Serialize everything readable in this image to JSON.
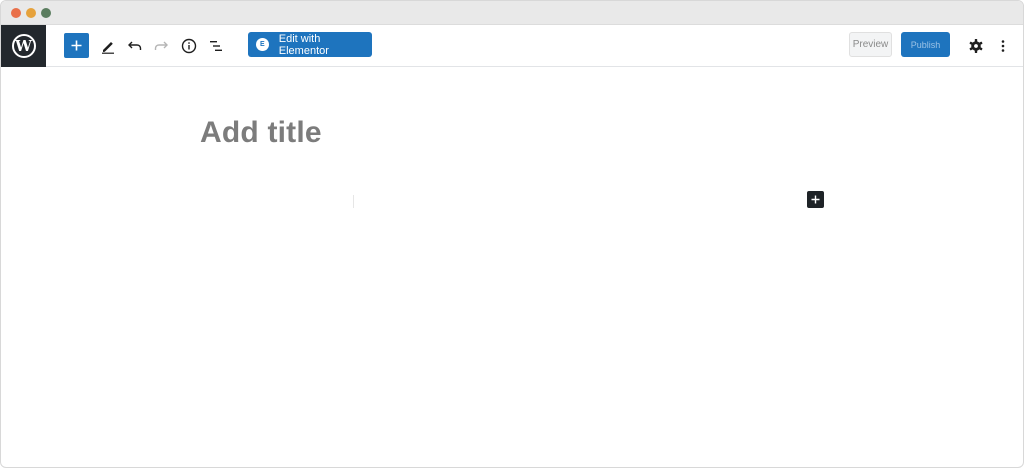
{
  "colors": {
    "chrome_red": "#e9704a",
    "chrome_yellow": "#e6a23c",
    "chrome_green": "#5b7d5f",
    "wp_logo_bg": "#23282d",
    "primary_blue": "#1e74be",
    "icon_dark": "#1e1e1e",
    "icon_disabled": "#b5b5b5",
    "title_placeholder": "#7c7c7c",
    "block_add_bg": "#1e2327"
  },
  "toolbar": {
    "logo_glyph": "W",
    "add_block_icon": "plus-icon",
    "tools_icon": "pencil-icon",
    "undo_icon": "undo-icon",
    "redo_icon": "redo-icon",
    "details_icon": "info-icon",
    "outline_icon": "list-view-icon",
    "elementor_button_label": "Edit with Elementor",
    "elementor_icon_glyph": "E",
    "preview_label": "Preview",
    "publish_label": "Publish",
    "settings_icon": "gear-icon",
    "more_icon": "kebab-menu-icon"
  },
  "editor": {
    "title_placeholder": "Add title",
    "block_inserter_icon": "plus-icon"
  }
}
